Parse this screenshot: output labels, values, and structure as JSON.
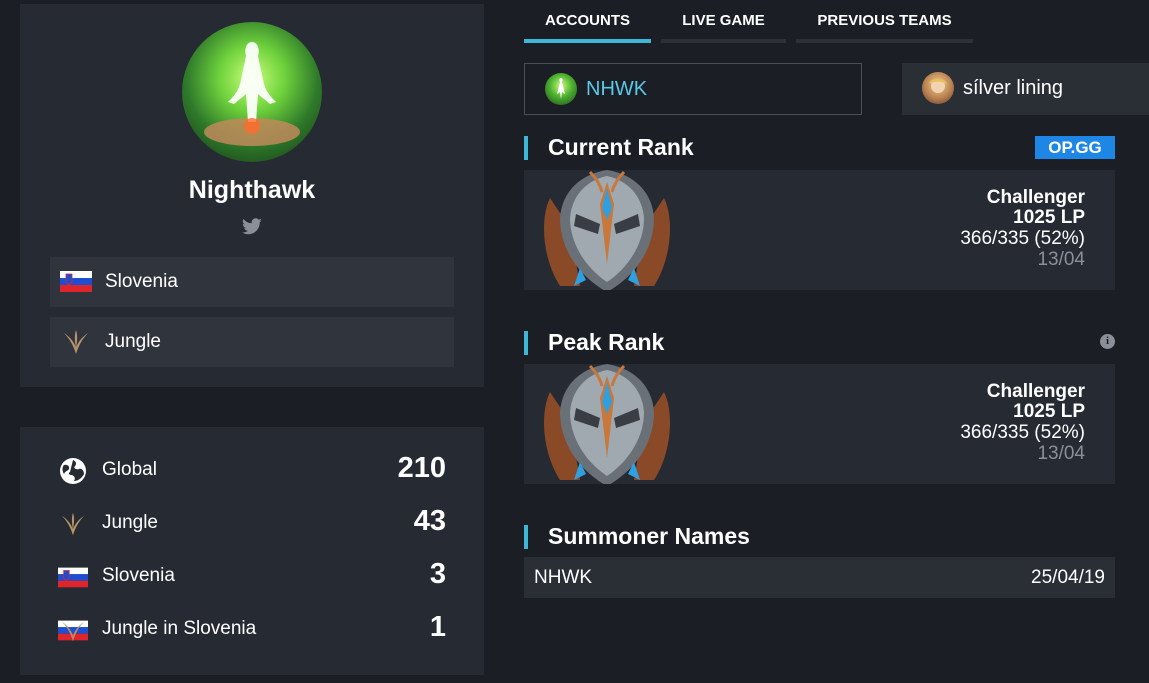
{
  "profile": {
    "name": "Nighthawk",
    "country": "Slovenia",
    "role": "Jungle"
  },
  "rankings": [
    {
      "label": "Global",
      "value": "210",
      "icon": "globe-icon"
    },
    {
      "label": "Jungle",
      "value": "43",
      "icon": "jungle-icon"
    },
    {
      "label": "Slovenia",
      "value": "3",
      "icon": "slovenia-flag-icon"
    },
    {
      "label": "Jungle in Slovenia",
      "value": "1",
      "icon": "jungle-slovenia-icon"
    }
  ],
  "tabs": [
    "ACCOUNTS",
    "LIVE GAME",
    "PREVIOUS TEAMS"
  ],
  "accounts": [
    {
      "name": "NHWK",
      "color": "#5bc8e8"
    },
    {
      "name": "sílver lining",
      "color": "#ffffff"
    }
  ],
  "current_rank": {
    "title": "Current Rank",
    "badge": "OP.GG",
    "tier": "Challenger",
    "lp": "1025 LP",
    "wl": "366/335 (52%)",
    "date": "13/04"
  },
  "peak_rank": {
    "title": "Peak Rank",
    "info": "i",
    "tier": "Challenger",
    "lp": "1025 LP",
    "wl": "366/335 (52%)",
    "date": "13/04"
  },
  "summoner_names": {
    "title": "Summoner Names",
    "rows": [
      {
        "name": "NHWK",
        "date": "25/04/19"
      }
    ]
  },
  "colors": {
    "accent": "#3fb8d8",
    "opgg": "#1e87e6",
    "background": "#1b1e24",
    "card": "#262a32"
  }
}
